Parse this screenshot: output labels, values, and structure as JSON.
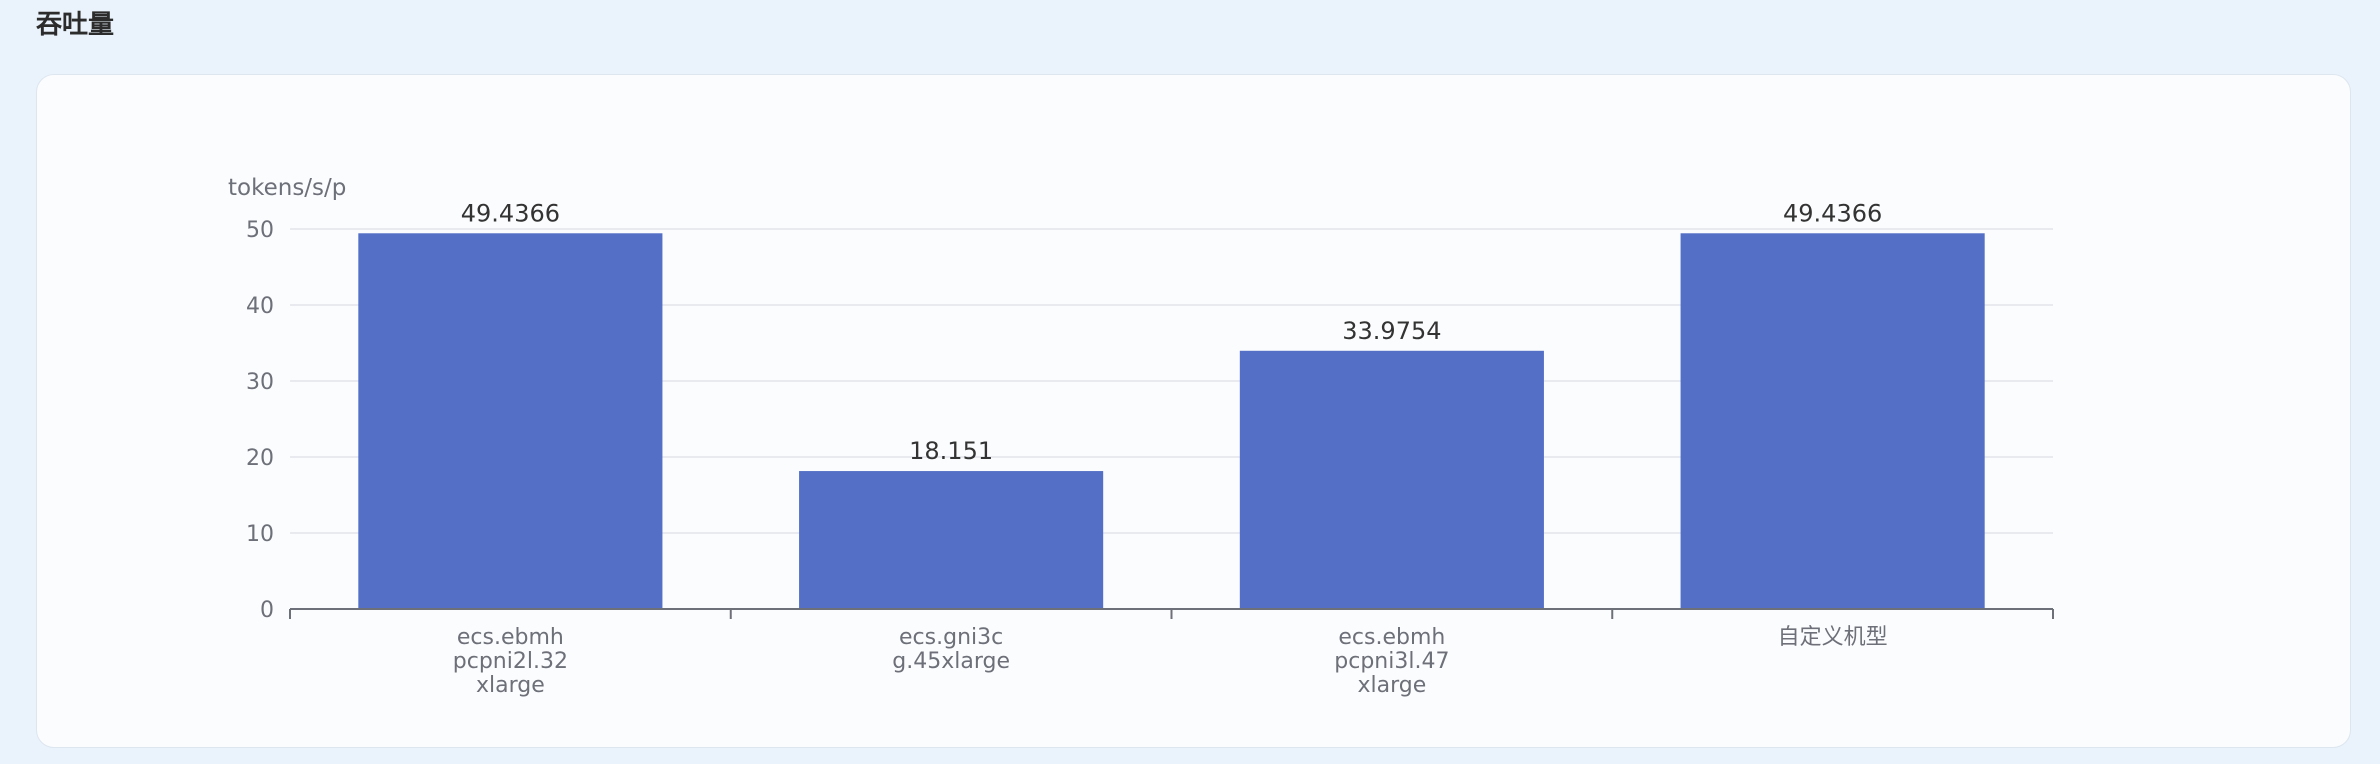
{
  "page": {
    "section_title": "吞吐量"
  },
  "chart_data": {
    "type": "bar",
    "unit_label": "tokens/s/p",
    "categories": [
      [
        "ecs.ebmh",
        "pcpni2l.32",
        "xlarge"
      ],
      [
        "ecs.gni3c",
        "g.45xlarge"
      ],
      [
        "ecs.ebmh",
        "pcpni3l.47",
        "xlarge"
      ],
      [
        "自定义机型"
      ]
    ],
    "values": [
      49.4366,
      18.151,
      33.9754,
      49.4366
    ],
    "value_labels": [
      "49.4366",
      "18.151",
      "33.9754",
      "49.4366"
    ],
    "ylim": [
      0,
      50
    ],
    "yticks": [
      0,
      10,
      20,
      30,
      40,
      50
    ],
    "grid": true,
    "bar_color": "#5470c6"
  }
}
